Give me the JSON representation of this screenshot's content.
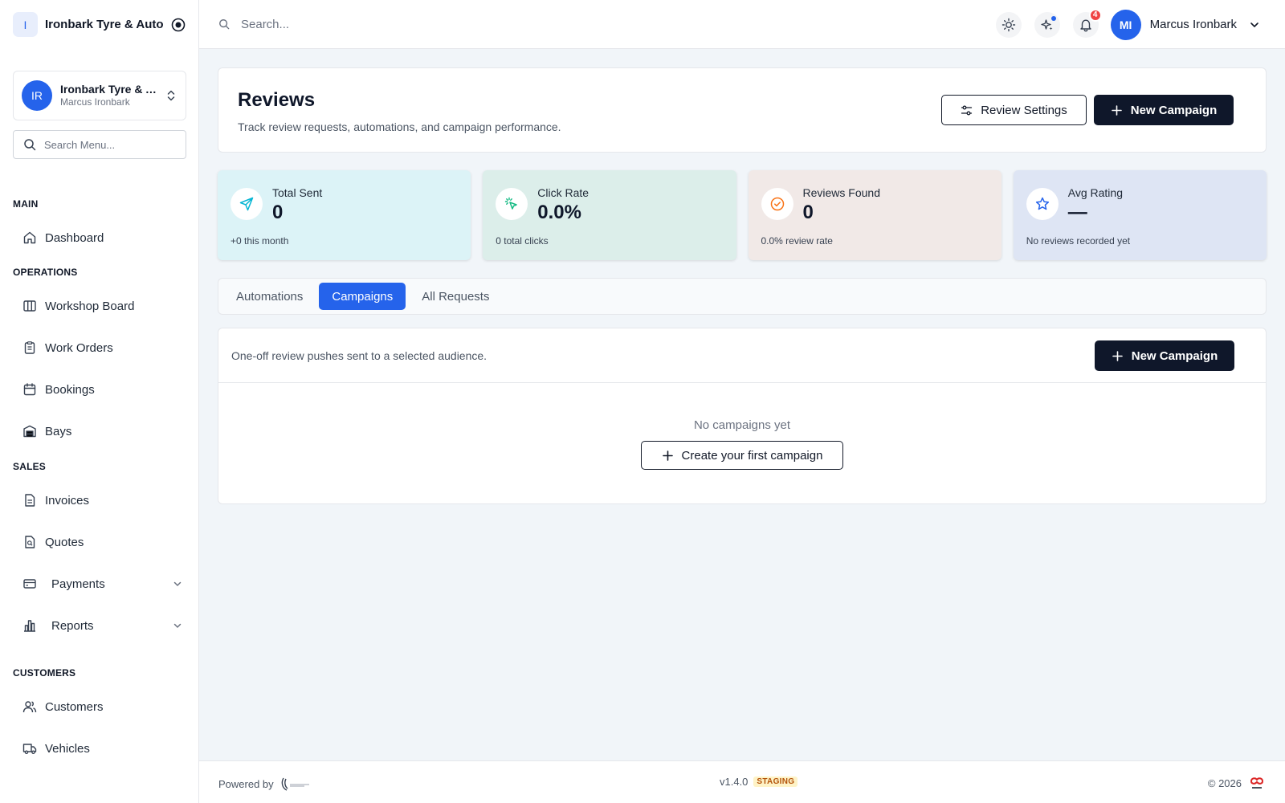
{
  "brand": {
    "initial": "I",
    "name": "Ironbark Tyre & Auto"
  },
  "org": {
    "initials": "IR",
    "title": "Ironbark Tyre & Auto",
    "subtitle": "Marcus Ironbark"
  },
  "menu_search": {
    "placeholder": "Search Menu..."
  },
  "sidebar": {
    "sections": [
      {
        "title": "MAIN",
        "items": [
          {
            "label": "Dashboard",
            "icon": "home-icon"
          }
        ]
      },
      {
        "title": "OPERATIONS",
        "items": [
          {
            "label": "Workshop Board",
            "icon": "columns-icon"
          },
          {
            "label": "Work Orders",
            "icon": "clipboard-icon"
          },
          {
            "label": "Bookings",
            "icon": "calendar-icon"
          },
          {
            "label": "Bays",
            "icon": "warehouse-icon"
          }
        ]
      },
      {
        "title": "SALES",
        "items": [
          {
            "label": "Invoices",
            "icon": "file-text-icon"
          },
          {
            "label": "Quotes",
            "icon": "file-search-icon"
          },
          {
            "label": "Payments",
            "icon": "credit-card-icon",
            "expandable": true
          },
          {
            "label": "Reports",
            "icon": "bar-chart-icon",
            "expandable": true
          }
        ]
      },
      {
        "title": "CUSTOMERS",
        "items": [
          {
            "label": "Customers",
            "icon": "users-icon"
          },
          {
            "label": "Vehicles",
            "icon": "truck-icon"
          }
        ]
      }
    ]
  },
  "topbar": {
    "search_placeholder": "Search...",
    "notifications_count": "4",
    "user_initials": "MI",
    "user_name": "Marcus Ironbark"
  },
  "page": {
    "title": "Reviews",
    "description": "Track review requests, automations, and campaign performance.",
    "settings_label": "Review Settings",
    "new_campaign_label": "New Campaign"
  },
  "stats": [
    {
      "label": "Total Sent",
      "value": "0",
      "foot": "+0 this month",
      "icon": "send-icon",
      "bg": "#dcf3f7",
      "accent": "#06b6d4"
    },
    {
      "label": "Click Rate",
      "value": "0.0%",
      "foot": "0 total clicks",
      "icon": "cursor-click-icon",
      "bg": "#dceeea",
      "accent": "#10b981"
    },
    {
      "label": "Reviews Found",
      "value": "0",
      "foot": "0.0% review rate",
      "icon": "check-circle-icon",
      "bg": "#f1e9e7",
      "accent": "#f97316"
    },
    {
      "label": "Avg Rating",
      "value": "—",
      "foot": "No reviews recorded yet",
      "icon": "star-icon",
      "bg": "#dee5f4",
      "accent": "#2563eb"
    }
  ],
  "tabs": [
    {
      "label": "Automations",
      "active": false
    },
    {
      "label": "Campaigns",
      "active": true
    },
    {
      "label": "All Requests",
      "active": false
    }
  ],
  "campaigns": {
    "description": "One-off review pushes sent to a selected audience.",
    "new_campaign_label": "New Campaign",
    "empty_text": "No campaigns yet",
    "create_first_label": "Create your first campaign"
  },
  "footer": {
    "powered_by": "Powered by",
    "version": "v1.4.0",
    "env": "STAGING",
    "copyright": "© 2026"
  }
}
